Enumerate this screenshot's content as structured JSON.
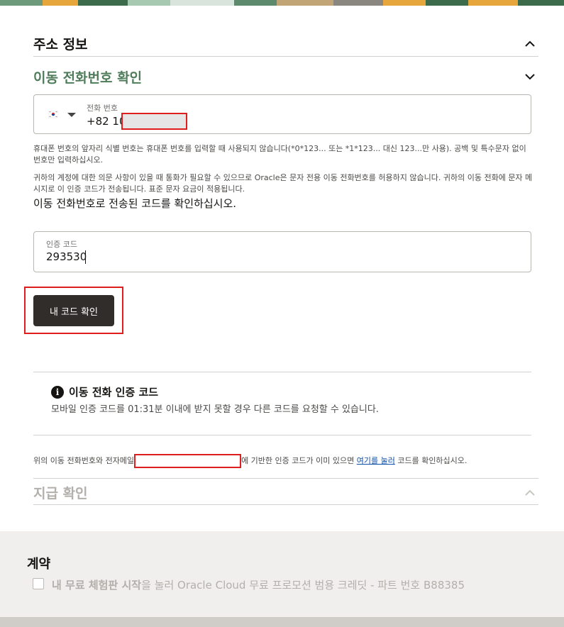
{
  "colors": {
    "accent_green": "#4f7d5b",
    "button_bg": "#312d2a",
    "highlight_red": "#e01e1e",
    "muted": "#b3afab"
  },
  "sections": {
    "address": {
      "title": "주소 정보",
      "icon": "chevron-up-icon"
    },
    "mobile": {
      "title": "이동 전화번호 확인",
      "icon": "chevron-down-icon"
    },
    "payment": {
      "title": "지급 확인",
      "icon": "chevron-up-icon"
    }
  },
  "phone": {
    "label": "전화 번호",
    "country_flag": "south-korea-flag-icon",
    "value_prefix": "+82 10",
    "help_1": "휴대폰 번호의 앞자리 식별 번호는 휴대폰 번호를 입력할 때 사용되지 않습니다(*0*123... 또는 *1*123... 대신 123...만 사용). 공백 및 특수문자 없이 번호만 입력하십시오.",
    "help_2": "귀하의 계정에 대한 의문 사항이 있을 때 통화가 필요할 수 있으므로 Oracle은 문자 전용 이동 전화번호를 허용하지 않습니다. 귀하의 이동 전화에 문자 메시지로 이 인증 코드가 전송됩니다. 표준 문자 요금이 적용됩니다."
  },
  "verify": {
    "instruction": "이동 전화번호로 전송된 코드를 확인하십시오.",
    "code_label": "인증 코드",
    "code_value": "293530",
    "button_label": "내 코드 확인"
  },
  "info": {
    "title": "이동 전화 인증 코드",
    "description": "모바일 인증 코드를 01:31분 이내에 받지 못할 경우 다른 코드를 요청할 수 있습니다."
  },
  "email_note": {
    "before": "위의 이동 전화번호와 전자메일",
    "after": "에 기반한 인증 코드가 이미 있으면 ",
    "link": "여기를 눌러",
    "end": " 코드를 확인하십시오."
  },
  "contract": {
    "title": "계약",
    "checkbox_bold": "내 무료 체험판 시작",
    "checkbox_rest": "을 눌러 Oracle Cloud 무료 프로모션 범용 크레딧 - 파트 번호 B88385"
  }
}
